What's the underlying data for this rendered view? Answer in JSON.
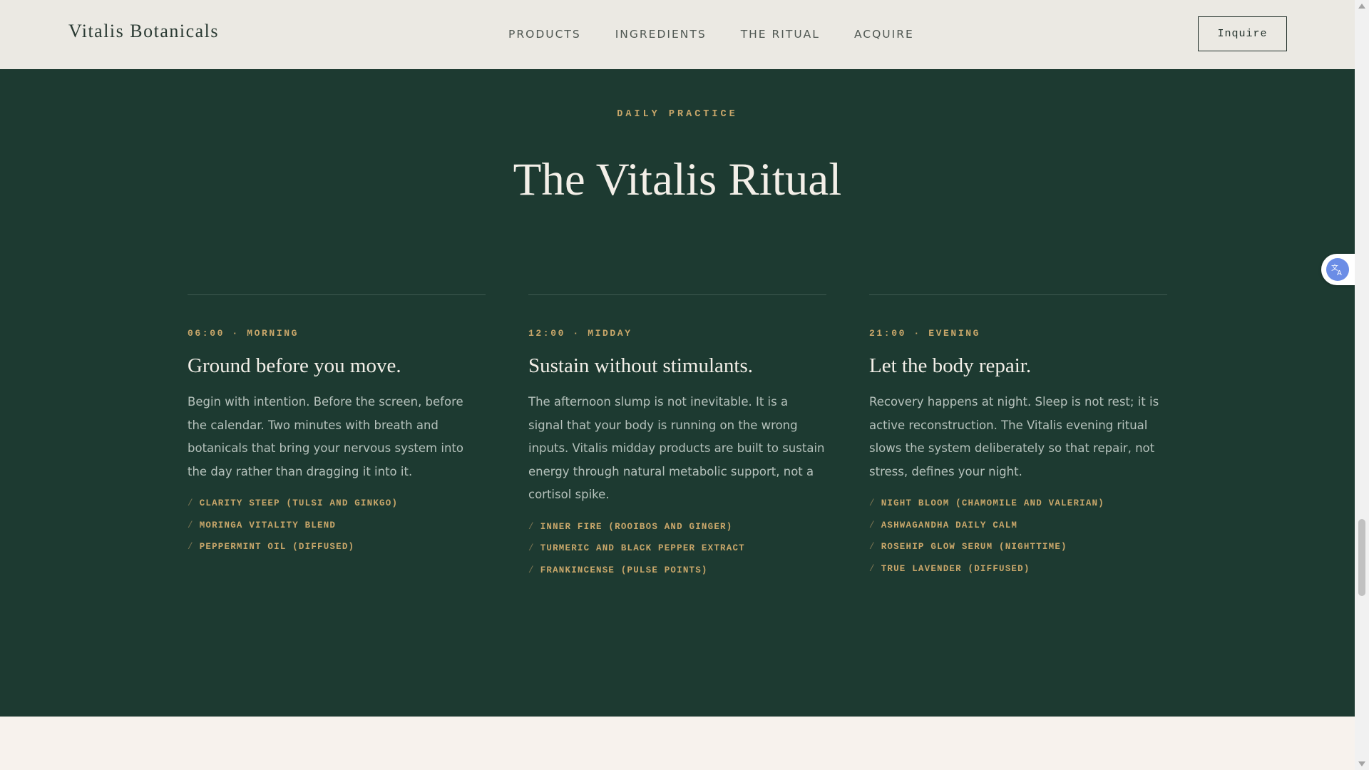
{
  "header": {
    "brand": "Vitalis Botanicals",
    "nav": [
      "PRODUCTS",
      "INGREDIENTS",
      "THE RITUAL",
      "ACQUIRE"
    ],
    "cta_label": "Inquire"
  },
  "ritual": {
    "eyebrow": "DAILY PRACTICE",
    "title": "The Vitalis Ritual",
    "columns": [
      {
        "time": "06:00 · MORNING",
        "heading": "Ground before you move.",
        "body": "Begin with intention. Before the screen, before the calendar. Two minutes with breath and botanicals that bring your nervous system into the day rather than dragging it into it.",
        "items": [
          "CLARITY STEEP (TULSI AND GINKGO)",
          "MORINGA VITALITY BLEND",
          "PEPPERMINT OIL (DIFFUSED)"
        ]
      },
      {
        "time": "12:00 · MIDDAY",
        "heading": "Sustain without stimulants.",
        "body": "The afternoon slump is not inevitable. It is a signal that your body is running on the wrong inputs. Vitalis midday products are built to sustain energy through natural metabolic support, not a cortisol spike.",
        "items": [
          "INNER FIRE (ROOIBOS AND GINGER)",
          "TURMERIC AND BLACK PEPPER EXTRACT",
          "FRANKINCENSE (PULSE POINTS)"
        ]
      },
      {
        "time": "21:00 · EVENING",
        "heading": "Let the body repair.",
        "body": "Recovery happens at night. Sleep is not rest; it is active reconstruction. The Vitalis evening ritual slows the system deliberately so that repair, not stress, defines your night.",
        "items": [
          "NIGHT BLOOM (CHAMOMILE AND VALERIAN)",
          "ASHWAGANDHA DAILY CALM",
          "ROSEHIP GLOW SERUM (NIGHTTIME)",
          "TRUE LAVENDER (DIFFUSED)"
        ]
      }
    ],
    "list_marker": "/"
  },
  "colors": {
    "header_bg": "#ebe9e3",
    "section_bg": "#1d3a31",
    "accent_gold": "#c9a76a",
    "heading_text": "#f3efe8",
    "body_text": "#b5c1bb",
    "page_bg": "#f7f2ed"
  },
  "icons": {
    "translate": "translate-icon"
  }
}
